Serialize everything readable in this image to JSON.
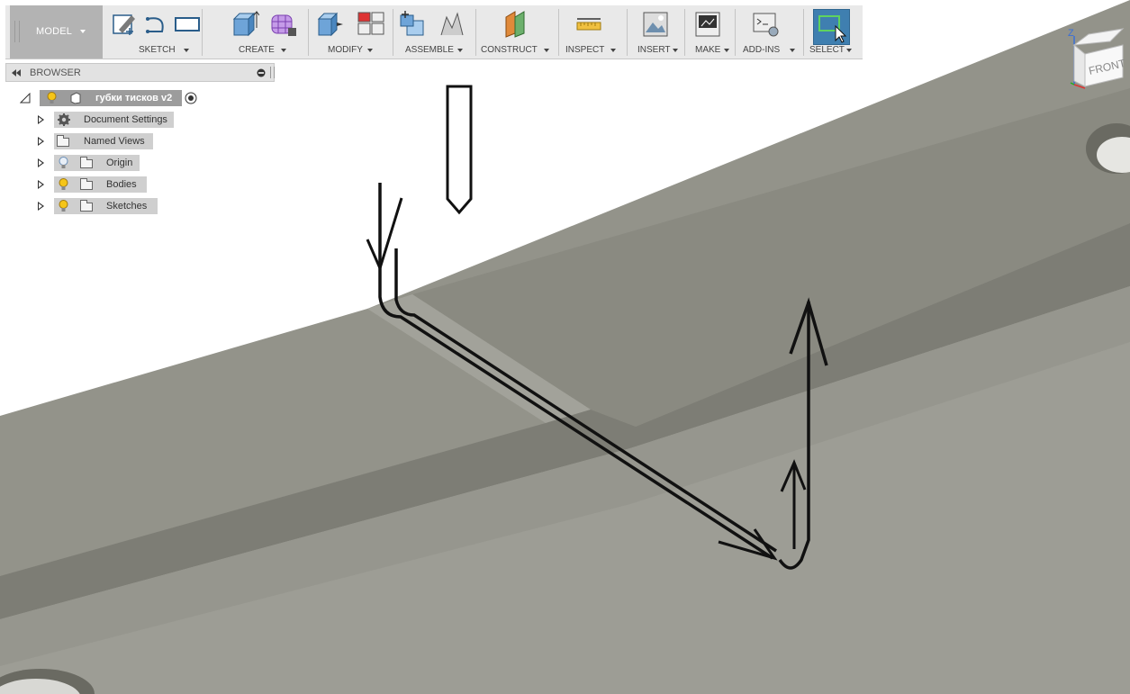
{
  "workspace": {
    "label": "MODEL"
  },
  "toolbar": {
    "groups": [
      {
        "label": "SKETCH"
      },
      {
        "label": "CREATE"
      },
      {
        "label": "MODIFY"
      },
      {
        "label": "ASSEMBLE"
      },
      {
        "label": "CONSTRUCT"
      },
      {
        "label": "INSPECT"
      },
      {
        "label": "INSERT"
      },
      {
        "label": "MAKE"
      },
      {
        "label": "ADD-INS"
      },
      {
        "label": "SELECT"
      }
    ]
  },
  "browser": {
    "title": "BROWSER",
    "root": {
      "label": "губки тисков v2"
    },
    "items": [
      {
        "label": "Document Settings",
        "icon": "gear-icon"
      },
      {
        "label": "Named Views",
        "icon": "folder-icon"
      },
      {
        "label": "Origin",
        "icon": "lightbulb-off-icon"
      },
      {
        "label": "Bodies",
        "icon": "lightbulb-icon"
      },
      {
        "label": "Sketches",
        "icon": "lightbulb-icon"
      }
    ]
  },
  "viewcube": {
    "face": "FRONT",
    "axis": "Z"
  },
  "colors": {
    "accent": "#3f7fb0",
    "model_surface": "#8f8f86",
    "bulb": "#f5c518"
  }
}
